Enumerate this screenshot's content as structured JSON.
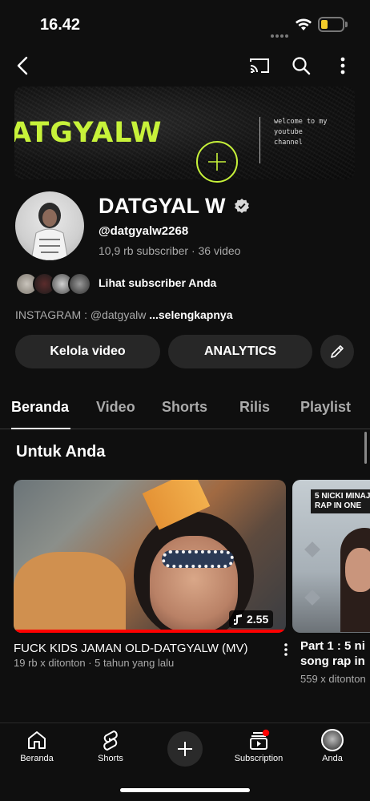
{
  "status_bar": {
    "time": "16.42"
  },
  "banner": {
    "brand_text": "ATGYALW",
    "welcome_text": "welcome to my\nyoutube\nchannel"
  },
  "channel": {
    "name": "DATGYAL W",
    "handle": "@datgyalw2268",
    "subscribers": "10,9 rb subscriber",
    "videos": "36 video",
    "subscribers_link": "Lihat subscriber Anda",
    "description": "INSTAGRAM : @datgyalw",
    "description_more": "...selengkapnya"
  },
  "actions": {
    "manage_videos": "Kelola video",
    "analytics": "ANALYTICS"
  },
  "tabs": [
    {
      "label": "Beranda",
      "active": true
    },
    {
      "label": "Video",
      "active": false
    },
    {
      "label": "Shorts",
      "active": false
    },
    {
      "label": "Rilis",
      "active": false
    },
    {
      "label": "Playlist",
      "active": false
    }
  ],
  "section": {
    "title": "Untuk Anda"
  },
  "videos": [
    {
      "title": "FUCK KIDS JAMAN OLD-DATGYALW (MV)",
      "meta": "19 rb x ditonton · 5 tahun yang lalu",
      "duration": "2.55",
      "watched_fraction": 1.0
    },
    {
      "title": "Part 1 : 5 ni\nsong rap in",
      "meta": "559 x ditonton",
      "thumb_label": "5 NICKI MINAJ\nRAP IN ONE"
    }
  ],
  "bottom_nav": {
    "home": "Beranda",
    "shorts": "Shorts",
    "subscriptions": "Subscription",
    "you": "Anda"
  },
  "colors": {
    "accent": "#c7f23a",
    "progress": "#ff0000",
    "background": "#0f0f0f",
    "chip": "#272727"
  },
  "icons": [
    "back-icon",
    "cast-icon",
    "search-icon",
    "more-vert-icon",
    "verified-icon",
    "pencil-icon",
    "music-note-icon",
    "home-icon",
    "shorts-icon",
    "plus-icon",
    "subscriptions-icon"
  ]
}
